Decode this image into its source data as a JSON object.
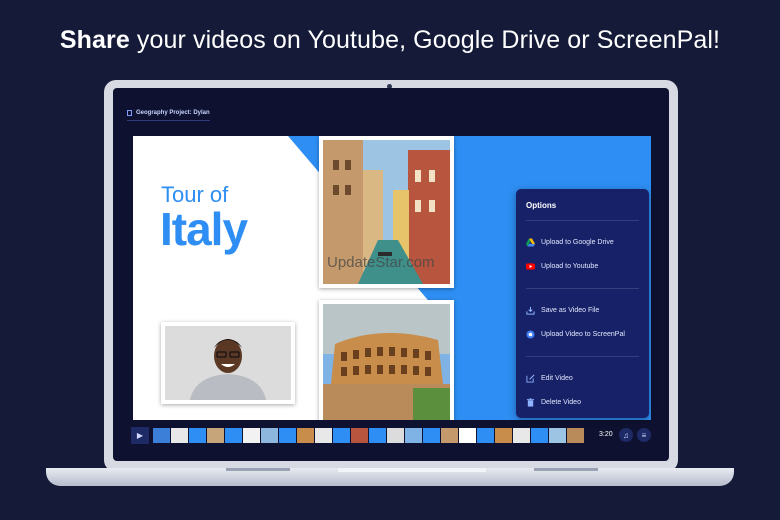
{
  "headline": {
    "bold": "Share",
    "rest": " your videos on Youtube, Google Drive or ScreenPal!"
  },
  "app": {
    "project_title": "Geography Project: Dylan"
  },
  "slide": {
    "tour_of": "Tour of",
    "italy": "Italy"
  },
  "watermark": "UpdateStar.com",
  "options_menu": {
    "title": "Options",
    "items": [
      {
        "label": "Upload to Google Drive",
        "icon": "google-drive-icon"
      },
      {
        "label": "Upload to Youtube",
        "icon": "youtube-icon"
      },
      {
        "label": "Save as Video File",
        "icon": "download-icon"
      },
      {
        "label": "Upload Video to ScreenPal",
        "icon": "screenpal-icon"
      },
      {
        "label": "Edit Video",
        "icon": "edit-icon"
      },
      {
        "label": "Delete Video",
        "icon": "trash-icon"
      }
    ]
  },
  "timeline": {
    "duration": "3:20",
    "play_icon": "play-icon",
    "music_icon": "music-note-icon",
    "menu_icon": "menu-icon"
  },
  "colors": {
    "accent_blue": "#2e8ef3",
    "menu_bg": "#172167",
    "page_bg": "#141a38"
  }
}
